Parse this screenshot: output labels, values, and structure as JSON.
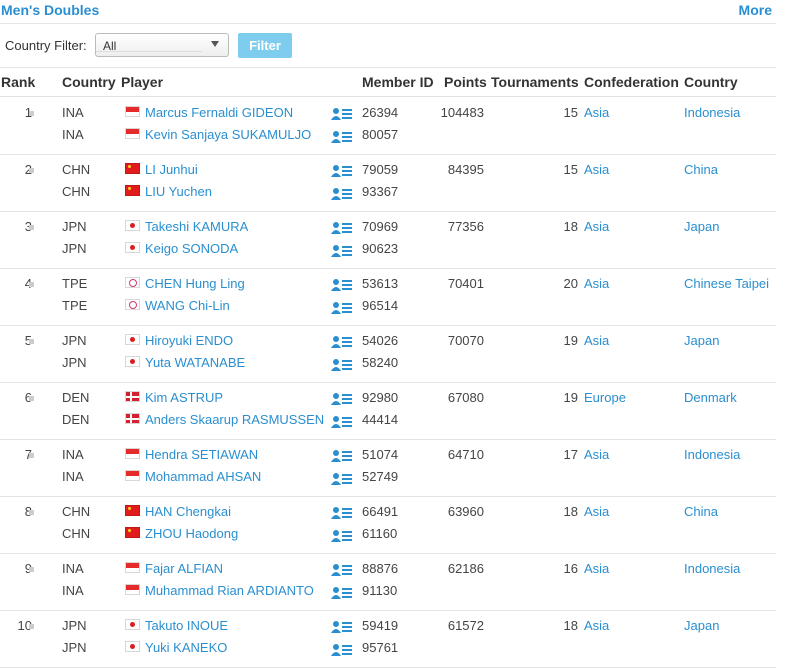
{
  "header": {
    "title": "Men's Doubles",
    "more_label": "More"
  },
  "filter": {
    "label": "Country Filter:",
    "selected": "All",
    "button_label": "Filter"
  },
  "columns": [
    "Rank",
    "Country",
    "Player",
    "Member ID",
    "Points",
    "Tournaments",
    "Confederation",
    "Country"
  ],
  "rows": [
    {
      "rank": "1",
      "points": "104483",
      "tournaments": "15",
      "confederation": "Asia",
      "country": "Indonesia",
      "players": [
        {
          "country": "INA",
          "name": "Marcus Fernaldi GIDEON",
          "member_id": "26394"
        },
        {
          "country": "INA",
          "name": "Kevin Sanjaya SUKAMULJO",
          "member_id": "80057"
        }
      ]
    },
    {
      "rank": "2",
      "points": "84395",
      "tournaments": "15",
      "confederation": "Asia",
      "country": "China",
      "players": [
        {
          "country": "CHN",
          "name": "LI Junhui",
          "member_id": "79059"
        },
        {
          "country": "CHN",
          "name": "LIU Yuchen",
          "member_id": "93367"
        }
      ]
    },
    {
      "rank": "3",
      "points": "77356",
      "tournaments": "18",
      "confederation": "Asia",
      "country": "Japan",
      "players": [
        {
          "country": "JPN",
          "name": "Takeshi KAMURA",
          "member_id": "70969"
        },
        {
          "country": "JPN",
          "name": "Keigo SONODA",
          "member_id": "90623"
        }
      ]
    },
    {
      "rank": "4",
      "points": "70401",
      "tournaments": "20",
      "confederation": "Asia",
      "country": "Chinese Taipei",
      "players": [
        {
          "country": "TPE",
          "name": "CHEN Hung Ling",
          "member_id": "53613"
        },
        {
          "country": "TPE",
          "name": "WANG Chi-Lin",
          "member_id": "96514"
        }
      ]
    },
    {
      "rank": "5",
      "points": "70070",
      "tournaments": "19",
      "confederation": "Asia",
      "country": "Japan",
      "players": [
        {
          "country": "JPN",
          "name": "Hiroyuki ENDO",
          "member_id": "54026"
        },
        {
          "country": "JPN",
          "name": "Yuta WATANABE",
          "member_id": "58240"
        }
      ]
    },
    {
      "rank": "6",
      "points": "67080",
      "tournaments": "19",
      "confederation": "Europe",
      "country": "Denmark",
      "players": [
        {
          "country": "DEN",
          "name": "Kim ASTRUP",
          "member_id": "92980"
        },
        {
          "country": "DEN",
          "name": "Anders Skaarup RASMUSSEN",
          "member_id": "44414"
        }
      ]
    },
    {
      "rank": "7",
      "points": "64710",
      "tournaments": "17",
      "confederation": "Asia",
      "country": "Indonesia",
      "players": [
        {
          "country": "INA",
          "name": "Hendra SETIAWAN",
          "member_id": "51074"
        },
        {
          "country": "INA",
          "name": "Mohammad AHSAN",
          "member_id": "52749"
        }
      ]
    },
    {
      "rank": "8",
      "points": "63960",
      "tournaments": "18",
      "confederation": "Asia",
      "country": "China",
      "players": [
        {
          "country": "CHN",
          "name": "HAN Chengkai",
          "member_id": "66491"
        },
        {
          "country": "CHN",
          "name": "ZHOU Haodong",
          "member_id": "61160"
        }
      ]
    },
    {
      "rank": "9",
      "points": "62186",
      "tournaments": "16",
      "confederation": "Asia",
      "country": "Indonesia",
      "players": [
        {
          "country": "INA",
          "name": "Fajar ALFIAN",
          "member_id": "88876"
        },
        {
          "country": "INA",
          "name": "Muhammad Rian ARDIANTO",
          "member_id": "91130"
        }
      ]
    },
    {
      "rank": "10",
      "points": "61572",
      "tournaments": "18",
      "confederation": "Asia",
      "country": "Japan",
      "players": [
        {
          "country": "JPN",
          "name": "Takuto INOUE",
          "member_id": "59419"
        },
        {
          "country": "JPN",
          "name": "Yuki KANEKO",
          "member_id": "95761"
        }
      ]
    }
  ],
  "icons": {
    "flag_icon": "country-flag-icon",
    "profile_icon": "player-profile-icon"
  },
  "colors": {
    "link": "#2a8fd0",
    "filter_button": "#7fcdee"
  }
}
